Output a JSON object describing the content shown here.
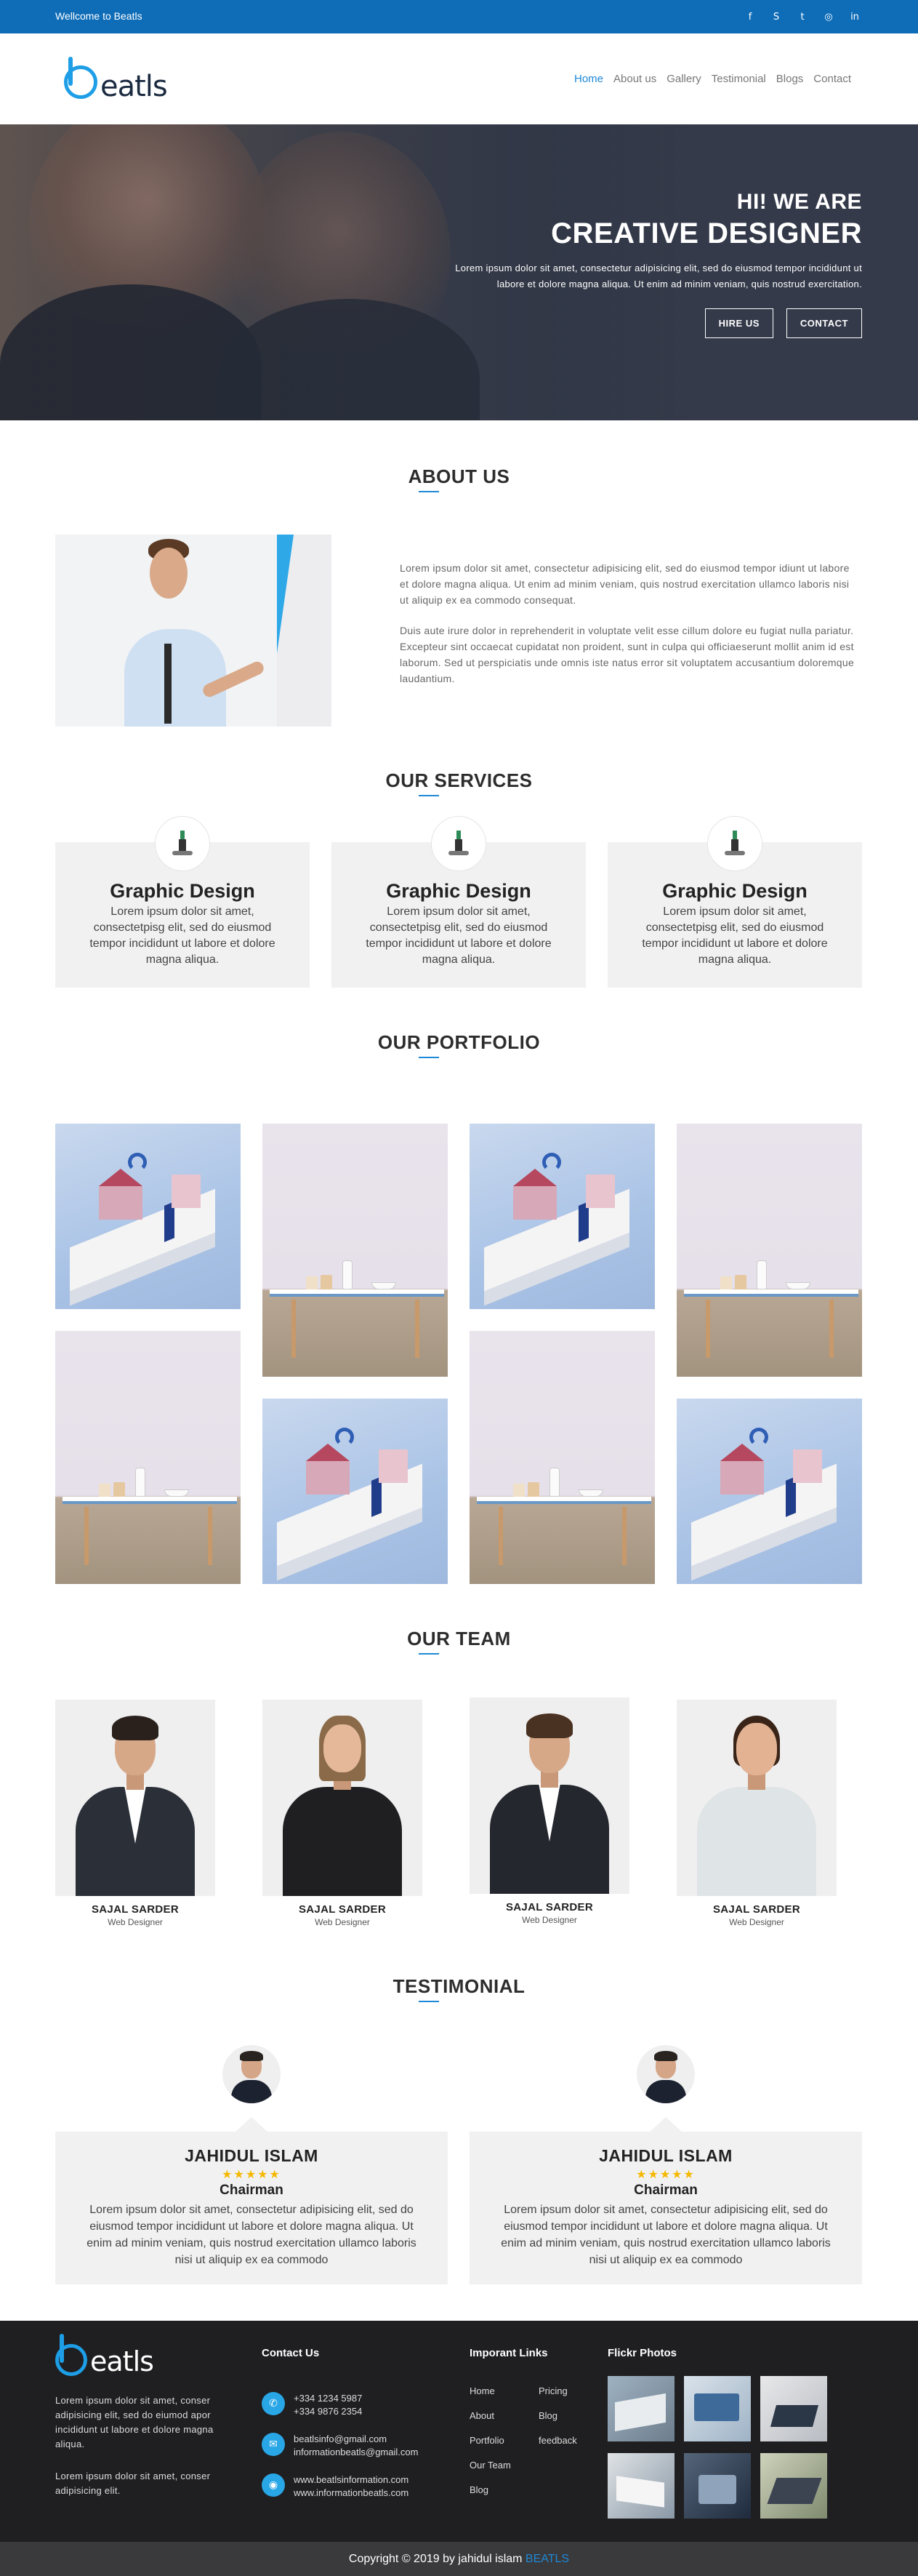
{
  "topbar": {
    "welcome": "Wellcome to Beatls",
    "socials": [
      {
        "icon": "facebook-icon",
        "glyph": "f"
      },
      {
        "icon": "skype-icon",
        "glyph": "S"
      },
      {
        "icon": "twitter-icon",
        "glyph": "t"
      },
      {
        "icon": "instagram-icon",
        "glyph": "◎"
      },
      {
        "icon": "linkedin-icon",
        "glyph": "in"
      }
    ]
  },
  "brand": {
    "logo_text": "eatls",
    "accent": "#1e88d6",
    "topbar_color": "#0f6db8"
  },
  "nav": {
    "items": [
      "Home",
      "About us",
      "Gallery",
      "Testimonial",
      "Blogs",
      "Contact"
    ],
    "active": "Home"
  },
  "hero": {
    "hi": "HI! WE ARE",
    "title": "CREATIVE DESIGNER",
    "desc": "Lorem ipsum dolor sit amet, consectetur adipisicing elit, sed do eiusmod tempor incididunt ut labore et dolore magna aliqua. Ut enim ad minim veniam, quis nostrud exercitation.",
    "btn_hire": "HIRE US",
    "btn_contact": "CONTACT"
  },
  "about": {
    "title": "ABOUT US",
    "p1": "Lorem ipsum dolor sit amet, consectetur adipisicing elit, sed do eiusmod tempor idiunt ut labore et dolore magna aliqua. Ut enim ad minim veniam, quis nostrud exercitation ullamco laboris nisi ut aliquip ex ea commodo consequat.",
    "p2": "Duis aute irure dolor in reprehenderit in voluptate velit esse cillum dolore eu fugiat nulla pariatur. Excepteur sint occaecat cupidatat non proident, sunt in culpa qui officiaeserunt mollit anim id est laborum. Sed ut perspiciatis unde omnis iste natus error sit voluptatem accusantium doloremque laudantium."
  },
  "services": {
    "title": "OUR SERVICES",
    "items": [
      {
        "title": "Graphic Design",
        "desc": "Lorem ipsum dolor sit amet, consectetpisg elit, sed do eiusmod tempor incididunt ut labore et dolore magna aliqua."
      },
      {
        "title": "Graphic Design",
        "desc": "Lorem ipsum dolor sit amet, consectetpisg elit, sed do eiusmod tempor incididunt ut labore et dolore magna aliqua."
      },
      {
        "title": "Graphic Design",
        "desc": "Lorem ipsum dolor sit amet, consectetpisg elit, sed do eiusmod tempor incididunt ut labore et dolore magna aliqua."
      }
    ]
  },
  "portfolio": {
    "title": "OUR PORTFOLIO"
  },
  "team": {
    "title": "OUR TEAM",
    "members": [
      {
        "name": "SAJAL SARDER",
        "role": "Web Designer"
      },
      {
        "name": "SAJAL SARDER",
        "role": "Web Designer"
      },
      {
        "name": "SAJAL SARDER",
        "role": "Web Designer"
      },
      {
        "name": "SAJAL SARDER",
        "role": "Web Designer"
      }
    ]
  },
  "testimonial": {
    "title": "TESTIMONIAL",
    "items": [
      {
        "name": "JAHIDUL ISLAM",
        "stars": "★★★★★",
        "role": "Chairman",
        "text": "Lorem ipsum dolor sit amet, consectetur adipisicing elit, sed do eiusmod tempor incididunt ut labore et dolore magna aliqua. Ut enim ad minim veniam, quis nostrud exercitation ullamco laboris nisi ut aliquip ex ea commodo"
      },
      {
        "name": "JAHIDUL ISLAM",
        "stars": "★★★★★",
        "role": "Chairman",
        "text": "Lorem ipsum dolor sit amet, consectetur adipisicing elit, sed do eiusmod tempor incididunt ut labore et dolore magna aliqua. Ut enim ad minim veniam, quis nostrud exercitation ullamco laboris nisi ut aliquip ex ea commodo"
      }
    ]
  },
  "footer": {
    "about_p1": "Lorem ipsum dolor sit amet, conser adipisicing elit, sed do eiumod apor incididunt ut labore et dolore magna aliqua.",
    "about_p2": "Lorem ipsum dolor sit amet, conser adipisicing elit.",
    "contact_title": "Contact Us",
    "phones": [
      "+334 1234 5987",
      "+334 9876 2354"
    ],
    "emails": [
      "beatlsinfo@gmail.com",
      "informationbeatls@gmail.com"
    ],
    "sites": [
      "www.beatlsinformation.com",
      "www.informationbeatls.com"
    ],
    "links_title": "Imporant Links",
    "links_col1": [
      "Home",
      "About",
      "Portfolio",
      "Our Team",
      "Blog"
    ],
    "links_col2": [
      "Pricing",
      "Blog",
      "feedback"
    ],
    "flickr_title": "Flickr Photos",
    "copyright": "Copyright © 2019 by jahidul islam",
    "copyright_brand": "BEATLS"
  }
}
